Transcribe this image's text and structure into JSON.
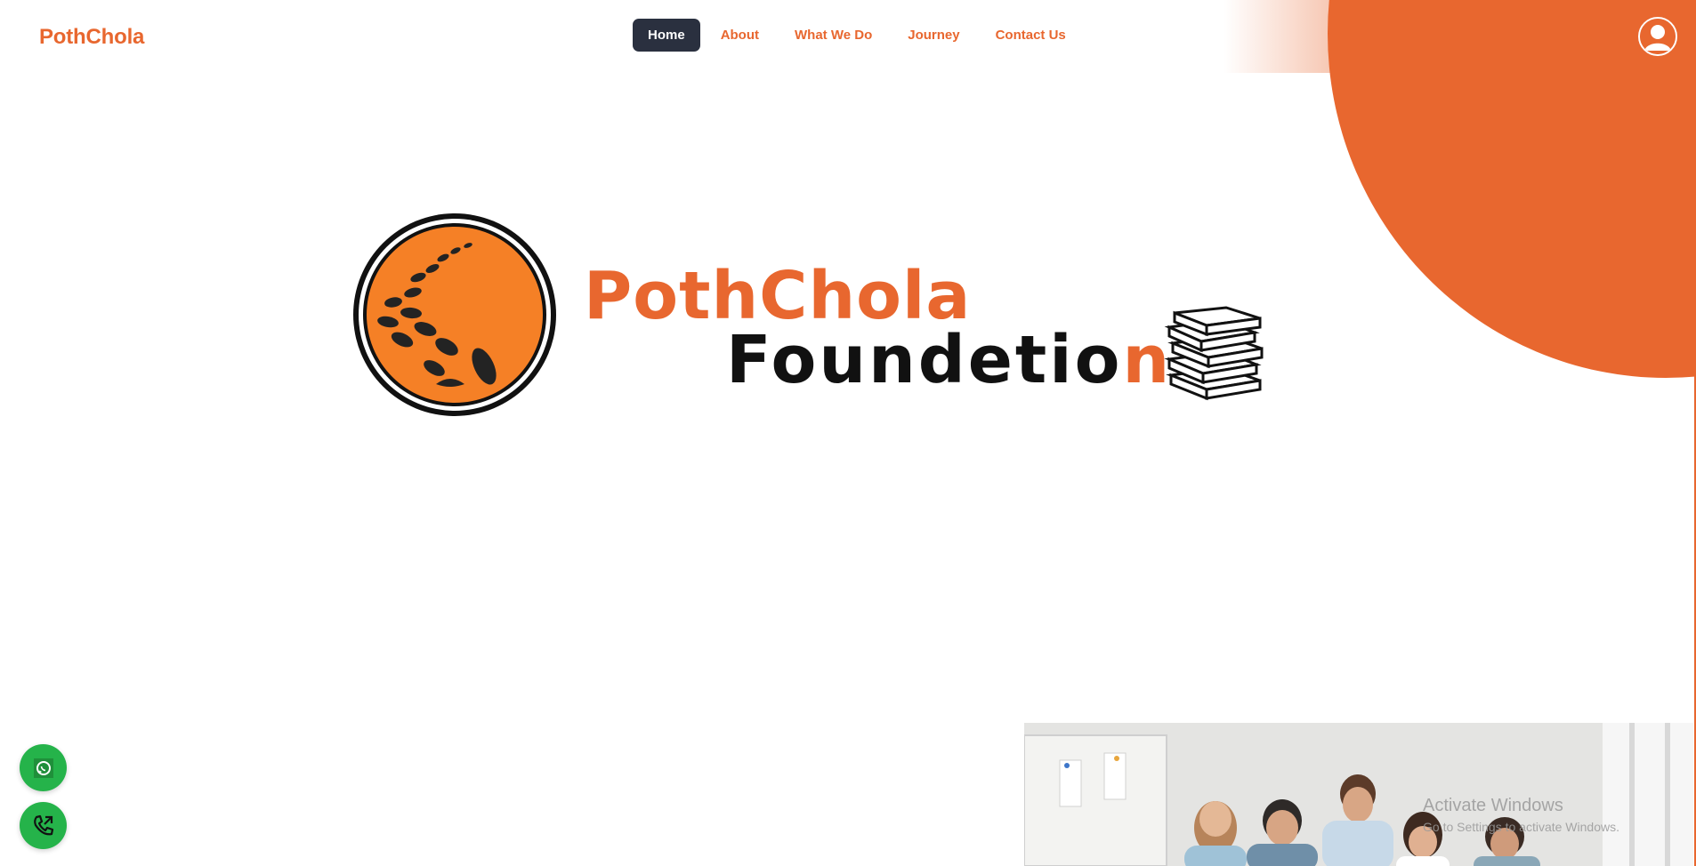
{
  "header": {
    "brand": "PothChola",
    "nav": [
      {
        "label": "Home",
        "active": true
      },
      {
        "label": "About",
        "active": false
      },
      {
        "label": "What We Do",
        "active": false
      },
      {
        "label": "Journey",
        "active": false
      },
      {
        "label": "Contact Us",
        "active": false
      }
    ],
    "avatar_icon": "user-avatar-icon"
  },
  "hero": {
    "logo_line_1": "PothChola",
    "logo_line_2_main": "Foundetio",
    "logo_line_2_accent": "n",
    "logo_icon": "footprints-circle-icon",
    "books_icon": "books-stack-icon"
  },
  "watermark": {
    "title": "Activate Windows",
    "subtitle": "Go to Settings to activate Windows."
  },
  "floating": {
    "whatsapp_icon": "whatsapp-icon",
    "phone_icon": "phone-call-icon"
  },
  "colors": {
    "brand": "#e8672f",
    "nav_active_bg": "#2a303f",
    "fab_green": "#25b34a"
  }
}
